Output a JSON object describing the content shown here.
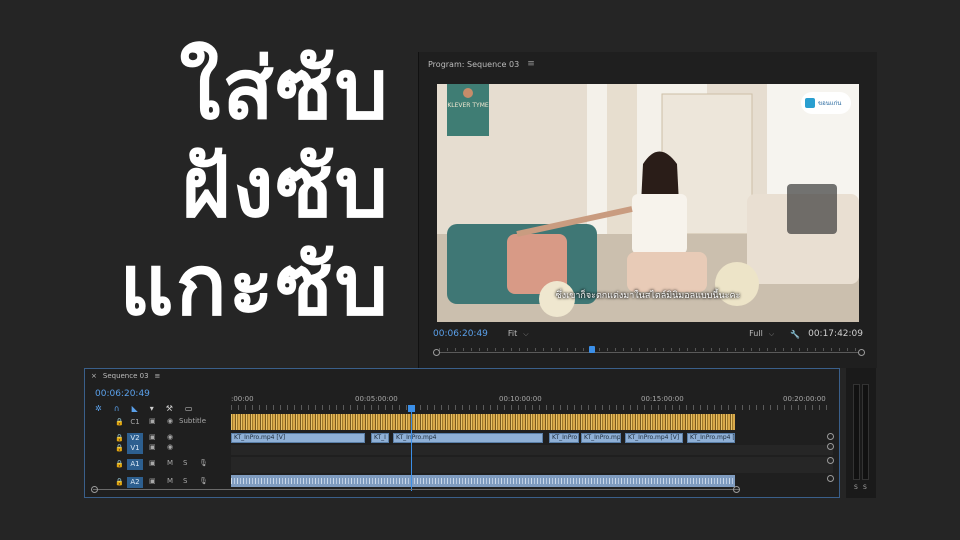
{
  "thumbnail_text": {
    "line1": "ใส่ซับ",
    "line2": "ฝังซับ",
    "line3": "แกะซับ"
  },
  "program_monitor": {
    "title": "Program: Sequence 03",
    "menu_icon": "hamburger-icon",
    "current_timecode": "00:06:20:49",
    "fit_value": "Fit",
    "quality_value": "Full",
    "wrench_icon": "wrench-icon",
    "duration": "00:17:42:09",
    "playhead_fraction": 0.36,
    "video": {
      "subtitle_text": "ซึ่งเขาก็จะตกแต่งมาในสไตล์มินิมอลแบบนี้นะคะ",
      "brand_badge": "KLEVER TYME",
      "partner_logo": "ขอนแก่น"
    }
  },
  "timeline": {
    "close_icon": "close-icon",
    "title": "Sequence 03",
    "menu_icon": "hamburger-icon",
    "timecode": "00:06:20:49",
    "ruler": [
      ":00:00",
      "00:05:00:00",
      "00:10:00:00",
      "00:15:00:00",
      "00:20:00:00"
    ],
    "tracks": [
      {
        "id": "C1",
        "label": "Subtitle"
      },
      {
        "id": "V2"
      },
      {
        "id": "V1"
      },
      {
        "id": "A1"
      },
      {
        "id": "A2"
      }
    ],
    "video_clips": [
      "KT_InPro.mp4 [V]",
      "KT_I",
      "KT_InPro.mp4",
      "KT_InPro",
      "KT_InPro.mp4 [V]",
      "KT_InPro.mp4 [V]",
      "KT_InPro.mp4 [V]"
    ],
    "track_toggle_m": "M",
    "track_toggle_s": "S"
  },
  "audio_meter": {
    "left_label": "S",
    "right_label": "S"
  }
}
